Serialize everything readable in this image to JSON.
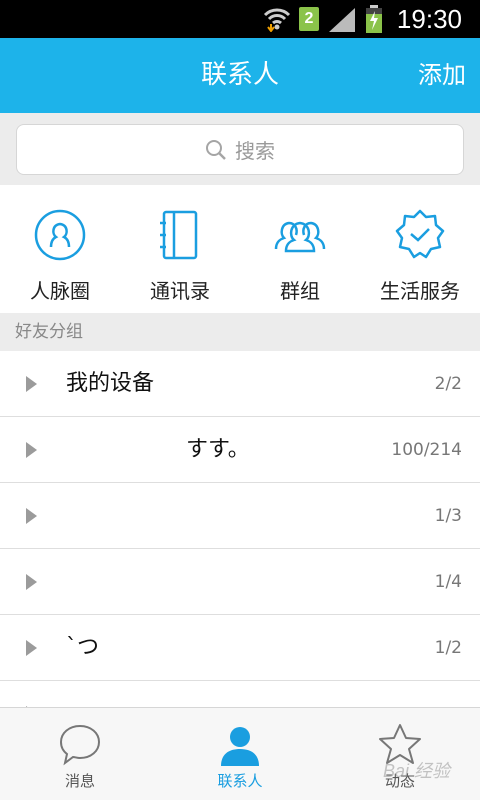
{
  "status_bar": {
    "time": "19:30",
    "sim_number": "2"
  },
  "header": {
    "title": "联系人",
    "add_label": "添加"
  },
  "search": {
    "placeholder": "搜索"
  },
  "quick_entries": [
    {
      "label": "人脉圈",
      "icon": "profile-circle-icon"
    },
    {
      "label": "通讯录",
      "icon": "address-book-icon"
    },
    {
      "label": "群组",
      "icon": "group-people-icon"
    },
    {
      "label": "生活服务",
      "icon": "service-badge-icon"
    }
  ],
  "section": {
    "title": "好友分组"
  },
  "groups": [
    {
      "name": "我的设备",
      "count": "2/2"
    },
    {
      "name": "すす。",
      "count": "100/214"
    },
    {
      "name": "",
      "count": "1/3"
    },
    {
      "name": "",
      "count": "1/4"
    },
    {
      "name": "`つ",
      "count": "1/2"
    }
  ],
  "bottom_nav": [
    {
      "label": "消息",
      "icon": "chat-bubble-icon",
      "active": false
    },
    {
      "label": "联系人",
      "icon": "contact-person-icon",
      "active": true
    },
    {
      "label": "动态",
      "icon": "star-icon",
      "active": false
    }
  ],
  "watermark": "Bai 经验",
  "colors": {
    "accent": "#1db3ea",
    "icon_blue": "#1a9ee0"
  }
}
